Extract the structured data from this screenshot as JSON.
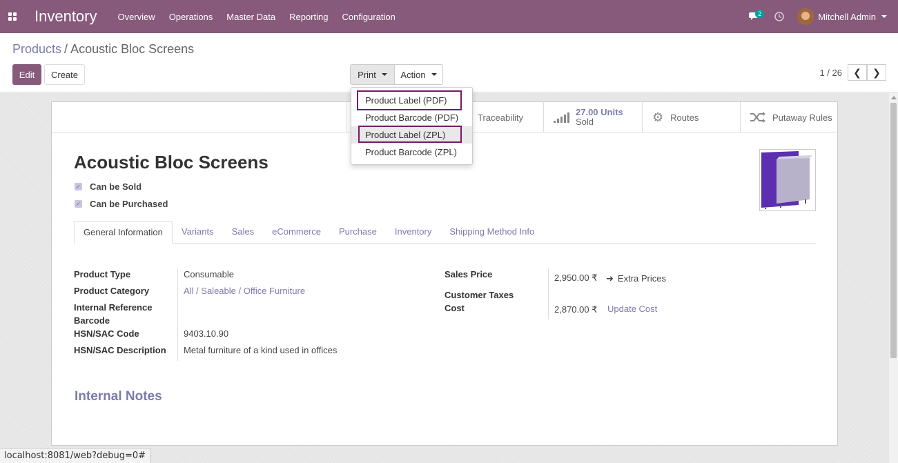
{
  "navbar": {
    "app_name": "Inventory",
    "menu": [
      "Overview",
      "Operations",
      "Master Data",
      "Reporting",
      "Configuration"
    ],
    "chat_count": "2",
    "user_name": "Mitchell Admin",
    "color": "#875a7b"
  },
  "breadcrumb": {
    "parent": "Products",
    "separator": "/",
    "current": "Acoustic Bloc Screens"
  },
  "buttons": {
    "edit": "Edit",
    "create": "Create",
    "print": "Print",
    "action": "Action"
  },
  "pager": {
    "value": "1 / 26"
  },
  "print_menu": {
    "items": [
      "Product Label (PDF)",
      "Product Barcode (PDF)",
      "Product Label (ZPL)",
      "Product Barcode (ZPL)"
    ]
  },
  "stat_buttons": {
    "traceability": "Traceability",
    "units_sold_value": "27.00 Units",
    "units_sold_label": "Sold",
    "routes": "Routes",
    "putaway": "Putaway Rules"
  },
  "product": {
    "name": "Acoustic Bloc Screens",
    "can_be_sold": "Can be Sold",
    "can_be_purchased": "Can be Purchased"
  },
  "tabs": [
    "General Information",
    "Variants",
    "Sales",
    "eCommerce",
    "Purchase",
    "Inventory",
    "Shipping Method Info"
  ],
  "general": {
    "product_type_label": "Product Type",
    "product_type": "Consumable",
    "category_label": "Product Category",
    "category": "All / Saleable / Office Furniture",
    "internal_ref_label": "Internal Reference",
    "barcode_label": "Barcode",
    "hsn_code_label": "HSN/SAC Code",
    "hsn_code": "9403.10.90",
    "hsn_desc_label": "HSN/SAC Description",
    "hsn_desc": "Metal furniture of a kind used in offices",
    "sales_price_label": "Sales Price",
    "sales_price": "2,950.00 ₹",
    "extra_prices": "Extra Prices",
    "customer_taxes_label": "Customer Taxes",
    "cost_label": "Cost",
    "cost": "2,870.00 ₹",
    "update_cost": "Update Cost"
  },
  "notes_heading": "Internal Notes",
  "status_url": "localhost:8081/web?debug=0#"
}
